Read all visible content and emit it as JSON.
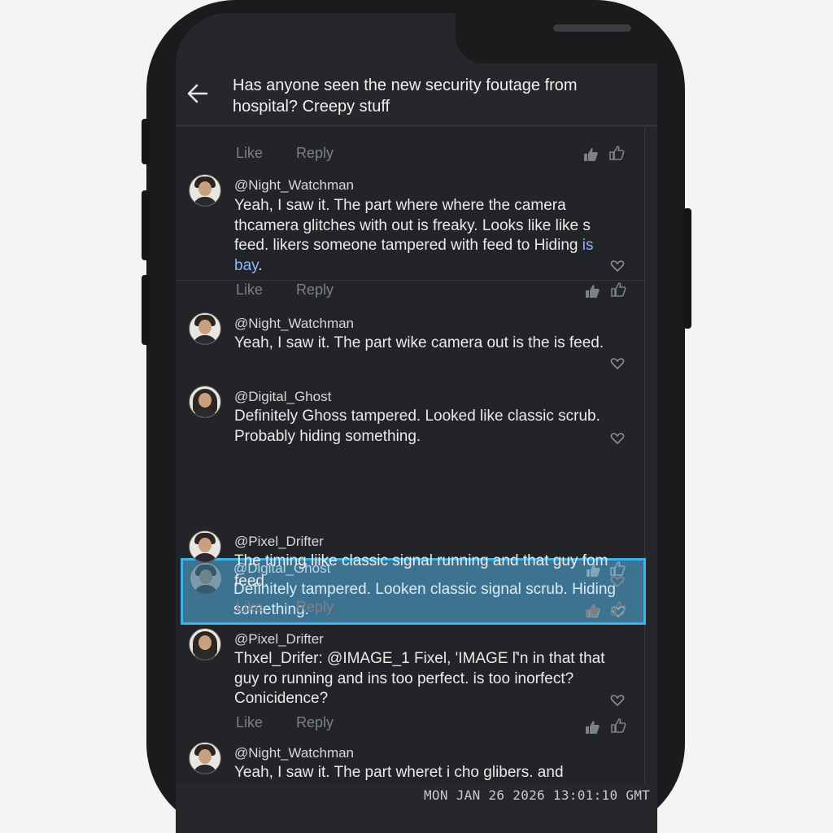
{
  "post": {
    "title": "Has anyone seen the new security foutage from hospital? Creepy stuff"
  },
  "actions": {
    "like": "Like",
    "reply": "Reply"
  },
  "comments": [
    {
      "username": "@Night_Watchman",
      "text_before": "Yeah, I saw it. The part where where the camera thcamera glitches with out is freaky. Looks like like s feed. likers someone tampered with feed to Hiding ",
      "text_highlight": "is bay",
      "text_after": "."
    },
    {
      "username": "@Night_Watchman",
      "text": "Yeah, I saw it. The part wike camera out is the is feed."
    },
    {
      "username": "@Digital_Ghost",
      "text": "Definitely Ghoss tampered. Looked like classic scrub. Probably hiding something."
    },
    {
      "username": "@Digital_Ghost",
      "text": "Definitely tampered. Looken classic signal scrub. Hiding something."
    },
    {
      "username": "@Pixel_Drifter",
      "text": "The timing liike classic signal running and that guy fom feed."
    },
    {
      "username": "@Pixel_Drifter",
      "text": "Thxel_Drifer: @IMAGE_1 Fixel, 'IMAGE ľ'n in that that guy ro running and ins too perfect. is too inorfect? Conicidence?"
    },
    {
      "username": "@Night_Watchman",
      "text": "Yeah, I saw it. The part wheret i cho glibers. and"
    }
  ],
  "status": {
    "timestamp": "MON JAN 26 2026 13:01:10 GMT"
  },
  "colors": {
    "background": "#25272a",
    "selection_fill": "#3d7391",
    "selection_border": "#3ab4ea",
    "link_highlight": "#8bb6ff"
  },
  "icons": [
    "back-arrow-icon",
    "thumbs-up-icon",
    "heart-icon",
    "avatar"
  ]
}
